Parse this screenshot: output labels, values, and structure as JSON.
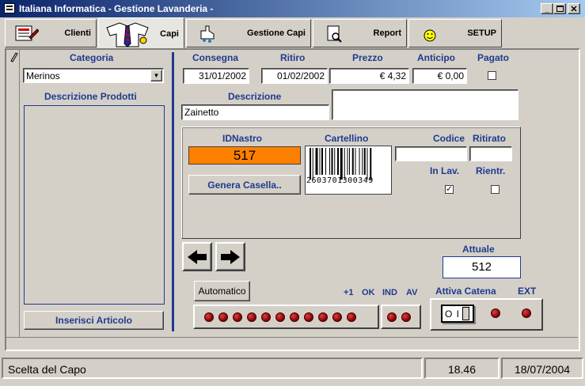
{
  "window": {
    "title": "Italiana Informatica - Gestione Lavanderia -"
  },
  "tabs": [
    {
      "label": "Clienti"
    },
    {
      "label": "Capi"
    },
    {
      "label": "Gestione Capi"
    },
    {
      "label": "Report"
    },
    {
      "label": "SETUP"
    }
  ],
  "left": {
    "categoria_label": "Categoria",
    "categoria_value": "Merinos",
    "descr_prodotti_label": "Descrizione Prodotti",
    "inserisci_label": "Inserisci Articolo"
  },
  "top": {
    "consegna_label": "Consegna",
    "consegna_value": "31/01/2002",
    "ritiro_label": "Ritiro",
    "ritiro_value": "01/02/2002",
    "prezzo_label": "Prezzo",
    "prezzo_value": "€ 4,32",
    "anticipo_label": "Anticipo",
    "anticipo_value": "€ 0,00",
    "pagato_label": "Pagato",
    "descrizione_label": "Descrizione",
    "descrizione_value": "Zainetto"
  },
  "mid": {
    "idnastro_label": "IDNastro",
    "idnastro_value": "517",
    "cartellino_label": "Cartellino",
    "barcode_number": "2603701300349",
    "codice_label": "Codice",
    "ritirato_label": "Ritirato",
    "inlav_label": "In Lav.",
    "rientr_label": "Rientr.",
    "genera_label": "Genera Casella.."
  },
  "bottom": {
    "attuale_label": "Attuale",
    "attuale_value": "512",
    "automatico_label": "Automatico",
    "plus1_label": "+1",
    "ok_label": "OK",
    "ind_label": "IND",
    "av_label": "AV",
    "attiva_label": "Attiva Catena",
    "ext_label": "EXT",
    "switch_label": "O I"
  },
  "status": {
    "message": "Scelta del Capo",
    "time": "18.46",
    "date": "18/07/2004"
  },
  "colors": {
    "title_bar": "#0a246a",
    "label": "#1f3a8f",
    "id_field": "#ff8000",
    "led": "#c00000"
  },
  "icons": [
    "window-app-icon",
    "minimize-icon",
    "maximize-icon",
    "close-icon",
    "clienti-icon",
    "capi-icon",
    "gestione-capi-icon",
    "report-icon",
    "setup-icon",
    "pencil-icon",
    "arrow-left-icon",
    "arrow-right-icon",
    "switch-icon"
  ]
}
